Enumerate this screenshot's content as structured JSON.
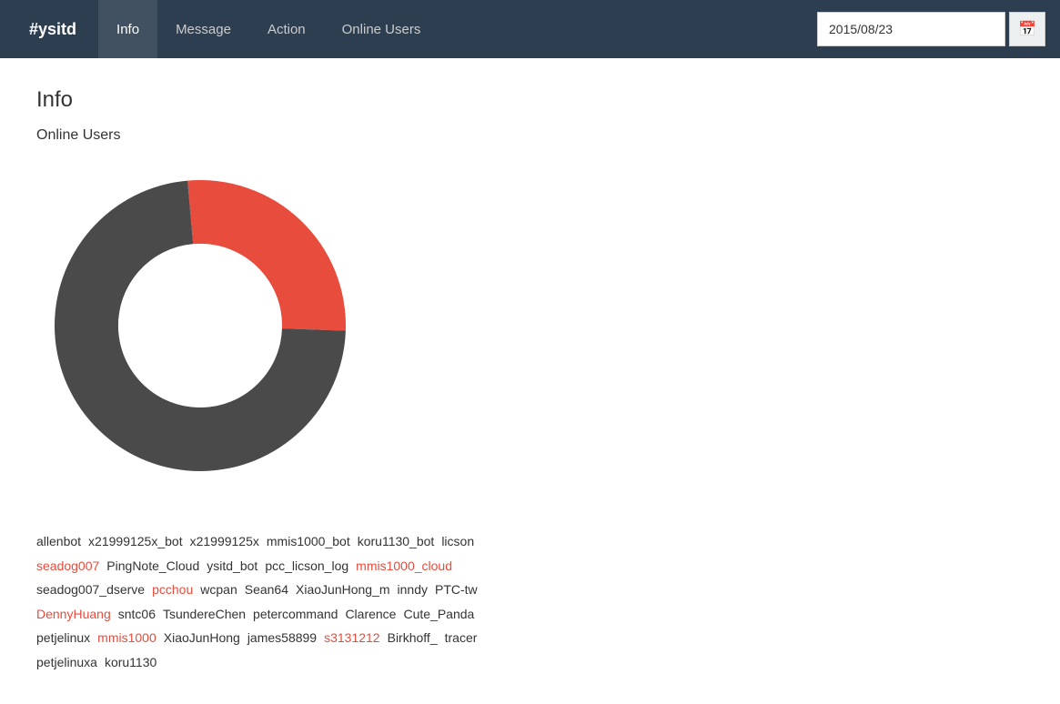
{
  "navbar": {
    "brand": "#ysitd",
    "items": [
      {
        "label": "Info",
        "active": true
      },
      {
        "label": "Message",
        "active": false
      },
      {
        "label": "Action",
        "active": false
      },
      {
        "label": "Online Users",
        "active": false
      }
    ],
    "date_value": "2015/08/23",
    "cal_icon": "📅"
  },
  "page": {
    "title": "Info",
    "section_title": "Online Users"
  },
  "chart": {
    "dark_color": "#4a4a4a",
    "red_color": "#e74c3c",
    "white_color": "#ffffff",
    "dark_percent": 75,
    "red_percent": 25
  },
  "users": [
    {
      "name": "allenbot",
      "red": false
    },
    {
      "name": "x21999125x_bot",
      "red": false
    },
    {
      "name": "x21999125x",
      "red": false
    },
    {
      "name": "mmis1000_bot",
      "red": false
    },
    {
      "name": "koru1130_bot",
      "red": false
    },
    {
      "name": "licson",
      "red": false
    },
    {
      "name": "seadog007",
      "red": true
    },
    {
      "name": "PingNote_Cloud",
      "red": false
    },
    {
      "name": "ysitd_bot",
      "red": false
    },
    {
      "name": "pcc_licson_log",
      "red": false
    },
    {
      "name": "mmis1000_cloud",
      "red": true
    },
    {
      "name": "seadog007_dserve",
      "red": false
    },
    {
      "name": "pcchou",
      "red": true
    },
    {
      "name": "wcpan",
      "red": false
    },
    {
      "name": "Sean64",
      "red": false
    },
    {
      "name": "XiaoJunHong_m",
      "red": false
    },
    {
      "name": "inndy",
      "red": false
    },
    {
      "name": "PTC-tw",
      "red": false
    },
    {
      "name": "DennyHuang",
      "red": true
    },
    {
      "name": "sntc06",
      "red": false
    },
    {
      "name": "TsundereChen",
      "red": false
    },
    {
      "name": "petercommand",
      "red": false
    },
    {
      "name": "Clarence",
      "red": false
    },
    {
      "name": "Cute_Panda",
      "red": false
    },
    {
      "name": "petjelinux",
      "red": false
    },
    {
      "name": "mmis1000",
      "red": true
    },
    {
      "name": "XiaoJunHong",
      "red": false
    },
    {
      "name": "james58899",
      "red": false
    },
    {
      "name": "s3131212",
      "red": true
    },
    {
      "name": "Birkhoff_",
      "red": false
    },
    {
      "name": "tracer",
      "red": false
    },
    {
      "name": "petjelinuxa",
      "red": false
    },
    {
      "name": "koru1130",
      "red": false
    }
  ]
}
